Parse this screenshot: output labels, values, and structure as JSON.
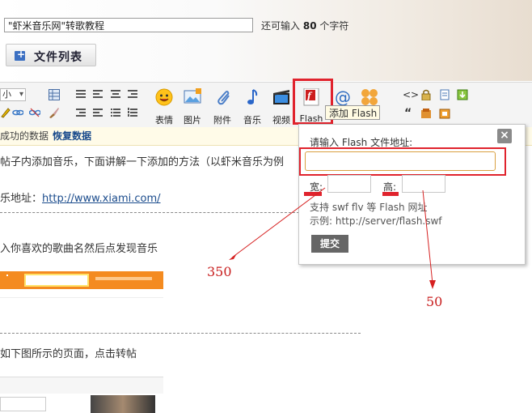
{
  "title_input": {
    "value": "\"虾米音乐网\"转歌教程"
  },
  "limit": {
    "prefix": "还可输入",
    "count": "80",
    "suffix": "个字符"
  },
  "file_list_button": {
    "label": "文件列表"
  },
  "toolbar": {
    "font_size_value": "小",
    "emoji_label": "表情",
    "image_label": "图片",
    "attachment_label": "附件",
    "music_label": "音乐",
    "video_label": "视频",
    "flash_label": "Flash",
    "flash_tooltip": "添加 Flash"
  },
  "restore_bar": {
    "text": "成功的数据",
    "link": "恢复数据"
  },
  "content": {
    "line1": "帖子内添加音乐，下面讲解一下添加的方法（以虾米音乐为例",
    "line2_prefix": "乐地址：",
    "line2_link": "http://www.xiami.com/",
    "line3": "入你喜欢的歌曲名然后点发现音乐",
    "line4": "如下图所示的页面，点击转帖"
  },
  "popup": {
    "title": "请输入 Flash 文件地址:",
    "url_value": "",
    "width_label": "宽:",
    "height_label": "高:",
    "hint_support": "支持 swf flv 等 Flash 网址",
    "hint_example": "示例: http://server/flash.swf",
    "submit_label": "提交",
    "close_label": "×"
  },
  "annotations": {
    "width_value": "350",
    "height_value": "50"
  },
  "colors": {
    "annotation_red": "#e0232d",
    "link_blue": "#1a4b8c"
  }
}
